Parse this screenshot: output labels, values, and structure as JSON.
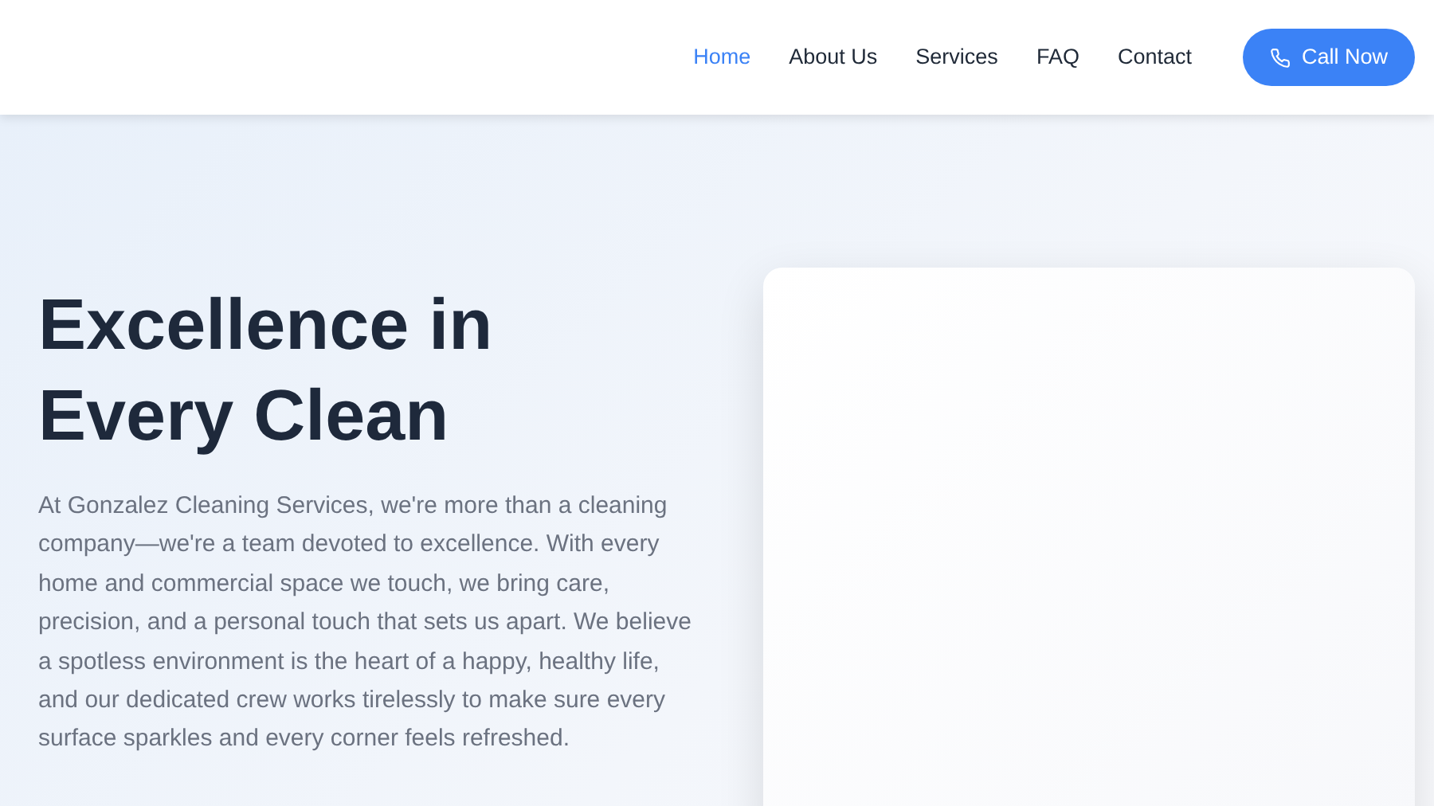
{
  "nav": {
    "links": [
      {
        "label": "Home",
        "selected": true
      },
      {
        "label": "About Us",
        "selected": false
      },
      {
        "label": "Services",
        "selected": false
      },
      {
        "label": "FAQ",
        "selected": false
      },
      {
        "label": "Contact",
        "selected": false
      }
    ],
    "cta": {
      "label": "Call Now"
    }
  },
  "hero": {
    "heading": "Excellence in Every Clean",
    "text": "At Gonzalez Cleaning Services, we're more than a cleaning company—we're a team devoted to excellence. With every home and commercial space we touch, we bring care, precision, and a personal touch that sets us apart. We believe a spotless environment is the heart of a happy, healthy life, and our dedicated crew works tirelessly to make sure every surface sparkles and every corner feels refreshed."
  }
}
